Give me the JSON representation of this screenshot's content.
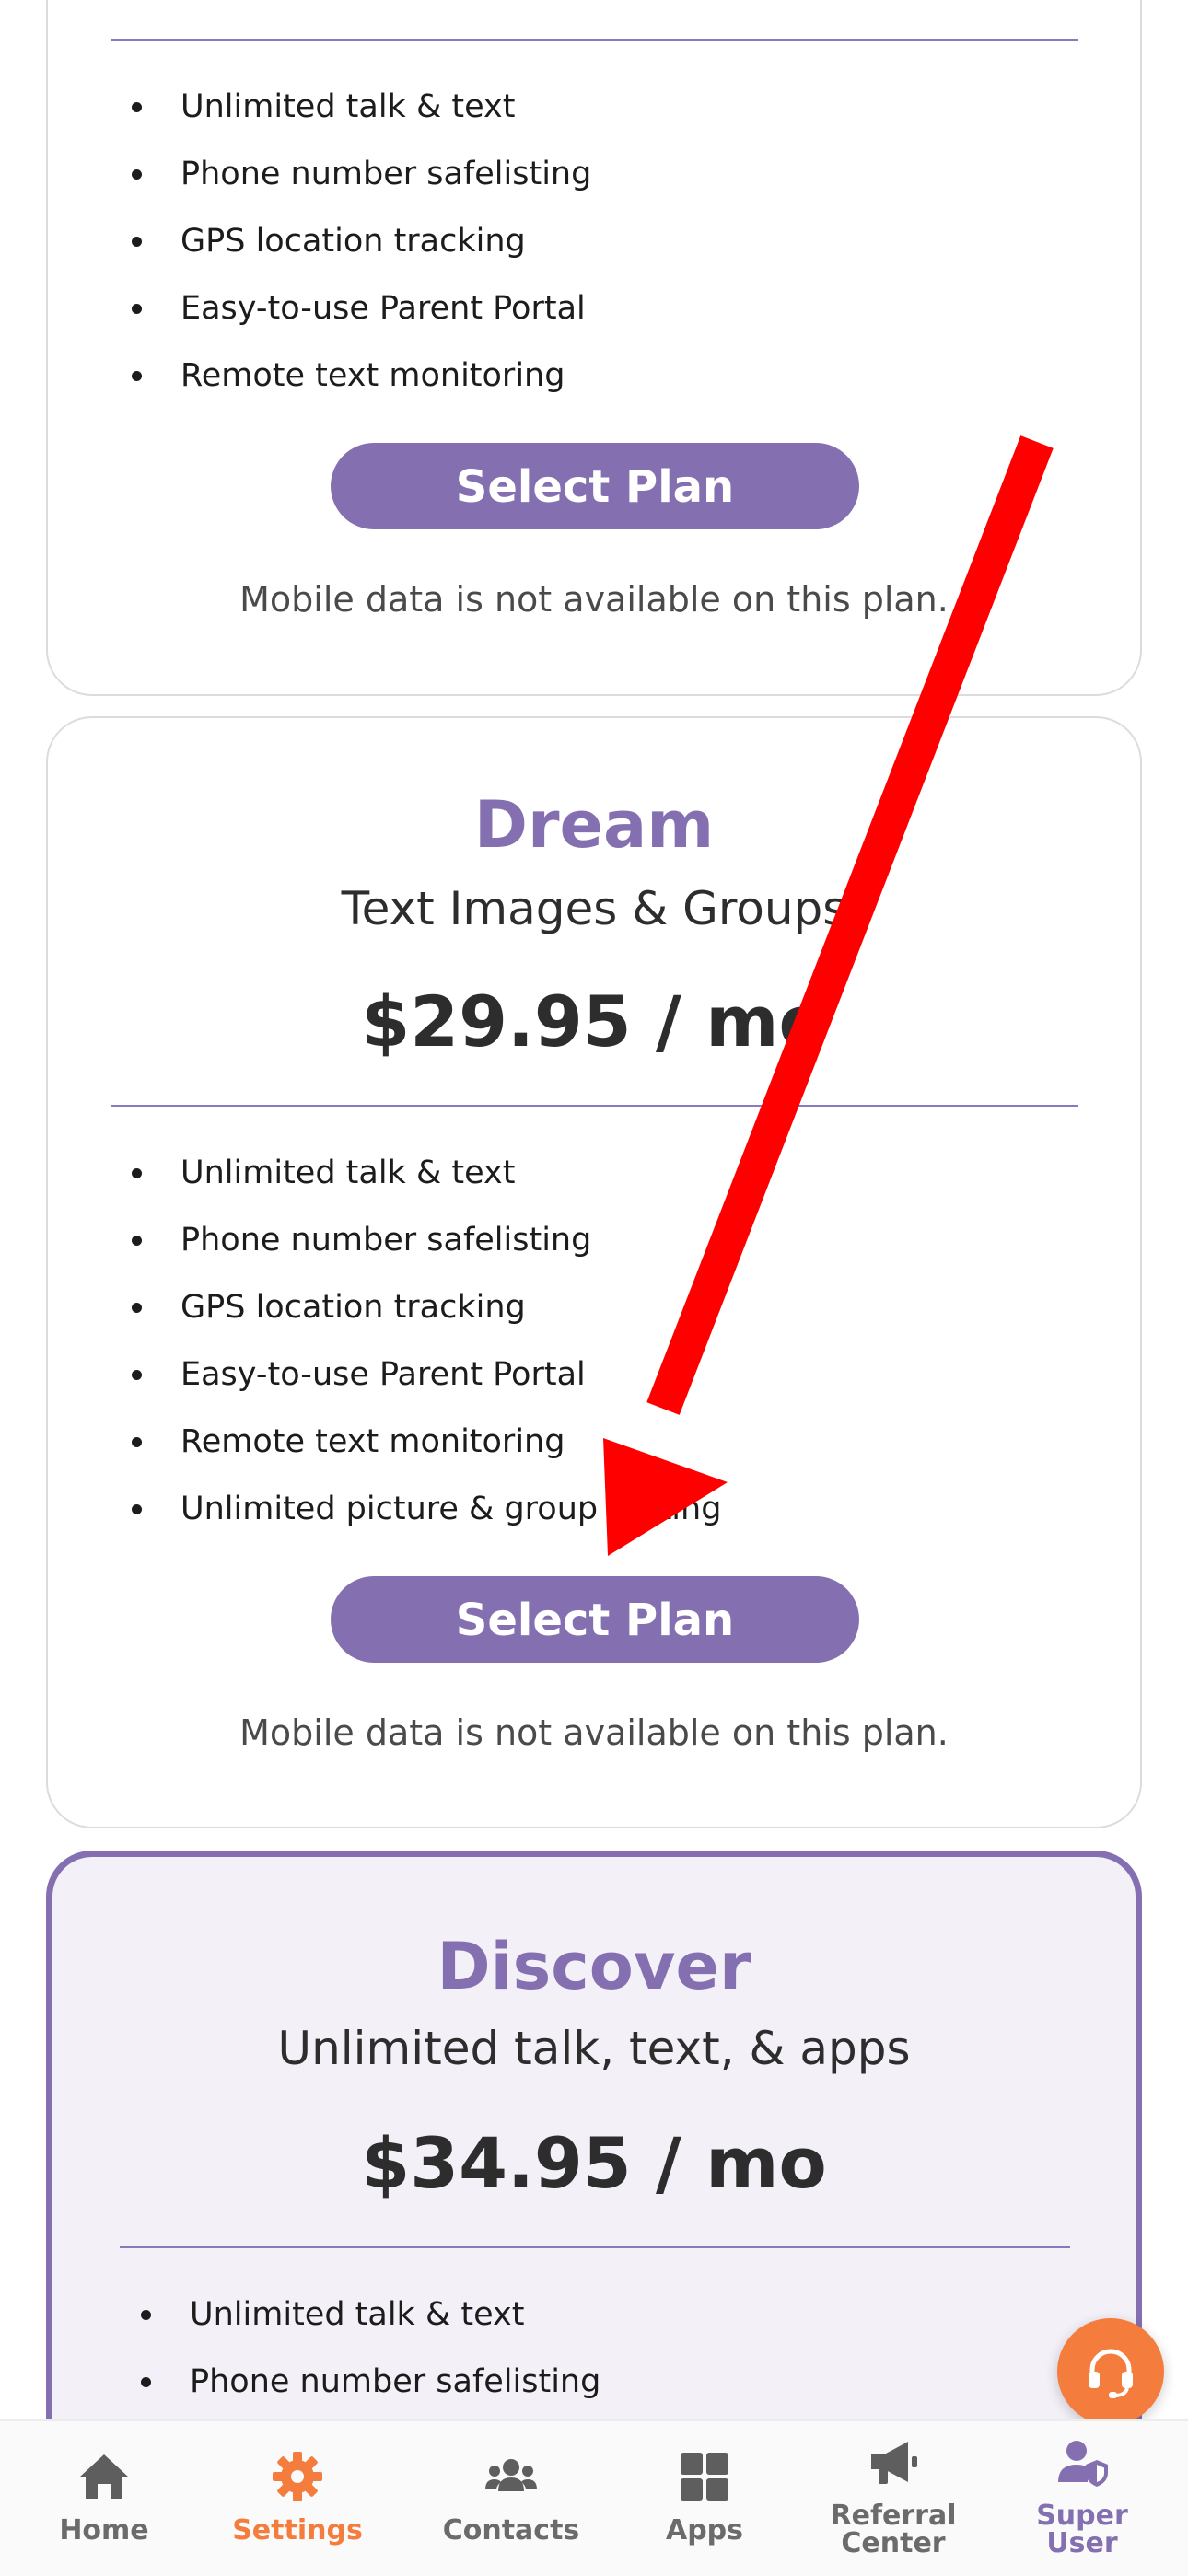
{
  "plans": [
    {
      "features": [
        "Unlimited talk & text",
        "Phone number safelisting",
        "GPS location tracking",
        "Easy-to-use Parent Portal",
        "Remote text monitoring"
      ],
      "button_label": "Select Plan",
      "note": "Mobile data is not available on this plan."
    },
    {
      "name": "Dream",
      "subtitle": "Text Images & Groups",
      "price": "$29.95 / mo",
      "features": [
        "Unlimited talk & text",
        "Phone number safelisting",
        "GPS location tracking",
        "Easy-to-use Parent Portal",
        "Remote text monitoring",
        "Unlimited picture & group texting"
      ],
      "button_label": "Select Plan",
      "note": "Mobile data is not available on this plan."
    },
    {
      "name": "Discover",
      "subtitle": "Unlimited talk, text, & apps",
      "price": "$34.95 / mo",
      "features": [
        "Unlimited talk & text",
        "Phone number safelisting"
      ]
    }
  ],
  "nav": {
    "items": [
      {
        "label": "Home",
        "icon": "home-icon"
      },
      {
        "label": "Settings",
        "icon": "gear-icon"
      },
      {
        "label": "Contacts",
        "icon": "contacts-icon"
      },
      {
        "label": "Apps",
        "icon": "apps-grid-icon"
      },
      {
        "label_line1": "Referral",
        "label_line2": "Center",
        "icon": "megaphone-icon"
      },
      {
        "label_line1": "Super",
        "label_line2": "User",
        "icon": "super-user-icon"
      }
    ],
    "active": "Settings"
  },
  "colors": {
    "accent": "#8470b0",
    "highlight": "#f47c3c",
    "annotation_arrow": "#ff0000"
  }
}
